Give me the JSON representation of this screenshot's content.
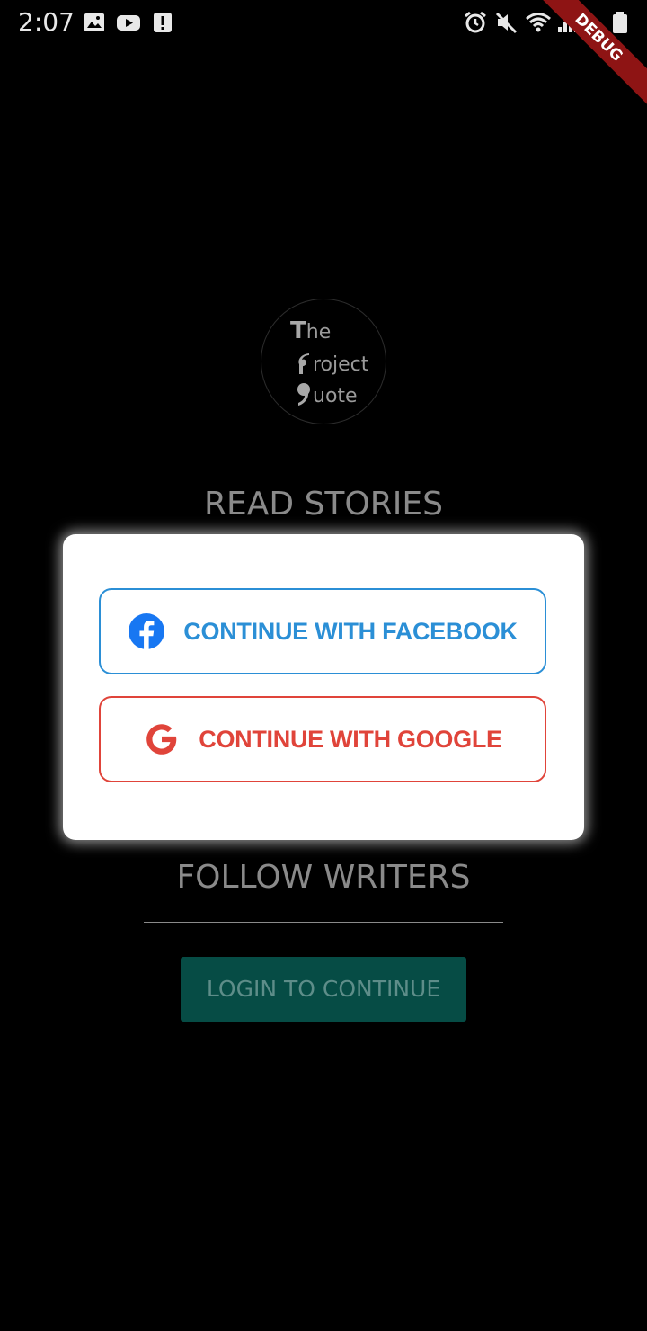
{
  "status_bar": {
    "time": "2:07",
    "left_icons": [
      "image-icon",
      "youtube-icon",
      "alert-icon"
    ],
    "right_icons": [
      "alarm-icon",
      "mute-icon",
      "wifi-icon",
      "signal-icon",
      "battery-icon"
    ]
  },
  "debug_banner": "DEBUG",
  "logo": {
    "line1_cap": "T",
    "line1_rest": "he",
    "line2_cap": "P",
    "line2_rest": "roject",
    "line3_cap": "Q",
    "line3_rest": "uote"
  },
  "background": {
    "read_stories": "READ STORIES",
    "follow_writers": "FOLLOW WRITERS",
    "login_button": "LOGIN TO CONTINUE"
  },
  "dialog": {
    "facebook_label": "CONTINUE WITH FACEBOOK",
    "google_label": "CONTINUE WITH GOOGLE"
  },
  "colors": {
    "facebook": "#2b8fd6",
    "google": "#e0443a",
    "login_button_bg": "#064c45",
    "debug_banner": "#8e1414"
  }
}
